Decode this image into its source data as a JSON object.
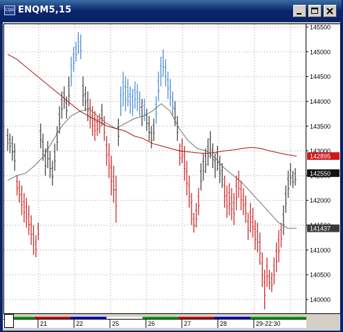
{
  "window": {
    "title": "ENQM5,15",
    "icon": "chart-app-icon",
    "icon_label": "CQG"
  },
  "colors": {
    "up": "#4f8ed6",
    "down": "#cc2a2a",
    "neutral": "#444444",
    "ma_slow": "#b01010",
    "ma_fast": "#707070",
    "label_red": "#cc1a1a",
    "label_black": "#111111",
    "label_grey": "#333333"
  },
  "price_axis": {
    "ticks": [
      "145500",
      "145000",
      "144500",
      "144000",
      "143500",
      "143000",
      "142500",
      "142000",
      "141500",
      "141000",
      "140500",
      "140000"
    ],
    "ylim": [
      139800,
      145600
    ],
    "markers": [
      {
        "value": "142895",
        "kind": "red"
      },
      {
        "value": "142550",
        "kind": "black"
      },
      {
        "value": "141437",
        "kind": "grey"
      }
    ]
  },
  "time_axis": {
    "labels": [
      "21",
      "22",
      "25",
      "26",
      "27",
      "28",
      "29-22:30"
    ],
    "segments": [
      {
        "color": "#00a000"
      },
      {
        "color": "#cc0000"
      },
      {
        "color": "#0000cc"
      },
      {
        "color": "#ffffff"
      },
      {
        "color": "#00a000"
      },
      {
        "color": "#cc0000"
      },
      {
        "color": "#0000cc"
      },
      {
        "color": "#00a000"
      }
    ]
  },
  "chart_data": {
    "type": "bar",
    "title": "ENQM5,15",
    "ylim": [
      139800,
      145600
    ],
    "bars": [
      [
        143450,
        143000,
        "n"
      ],
      [
        143350,
        142950,
        "n"
      ],
      [
        143300,
        142800,
        "n"
      ],
      [
        143150,
        142600,
        "n"
      ],
      [
        142500,
        142100,
        "d"
      ],
      [
        142400,
        141950,
        "d"
      ],
      [
        142300,
        141700,
        "d"
      ],
      [
        142150,
        141550,
        "d"
      ],
      [
        142050,
        141450,
        "d"
      ],
      [
        141900,
        141300,
        "d"
      ],
      [
        141700,
        141100,
        "d"
      ],
      [
        141500,
        140900,
        "d"
      ],
      [
        141300,
        140850,
        "d"
      ],
      [
        141550,
        141200,
        "d"
      ],
      [
        143550,
        143050,
        "n"
      ],
      [
        143350,
        142800,
        "n"
      ],
      [
        143050,
        142500,
        "n"
      ],
      [
        143200,
        142650,
        "n"
      ],
      [
        143000,
        142450,
        "n"
      ],
      [
        142800,
        142300,
        "n"
      ],
      [
        143150,
        142600,
        "n"
      ],
      [
        143500,
        143000,
        "n"
      ],
      [
        143900,
        143350,
        "n"
      ],
      [
        144200,
        143650,
        "n"
      ],
      [
        144300,
        143850,
        "n"
      ],
      [
        144100,
        143650,
        "n"
      ],
      [
        144500,
        143900,
        "n"
      ],
      [
        144900,
        144300,
        "u"
      ],
      [
        145100,
        144600,
        "u"
      ],
      [
        145200,
        144800,
        "u"
      ],
      [
        145400,
        144950,
        "u"
      ],
      [
        145350,
        144850,
        "u"
      ],
      [
        144500,
        143900,
        "n"
      ],
      [
        144300,
        143800,
        "n"
      ],
      [
        144200,
        143600,
        "n"
      ],
      [
        144050,
        143450,
        "d"
      ],
      [
        143900,
        143300,
        "d"
      ],
      [
        143800,
        143200,
        "d"
      ],
      [
        143700,
        143300,
        "d"
      ],
      [
        143750,
        143350,
        "d"
      ],
      [
        143950,
        143500,
        "n"
      ],
      [
        143700,
        143200,
        "d"
      ],
      [
        143300,
        142700,
        "d"
      ],
      [
        143150,
        142450,
        "d"
      ],
      [
        142900,
        142100,
        "d"
      ],
      [
        142700,
        141950,
        "d"
      ],
      [
        142500,
        141550,
        "d"
      ],
      [
        143650,
        143100,
        "n"
      ],
      [
        144300,
        143700,
        "u"
      ],
      [
        144600,
        143900,
        "u"
      ],
      [
        144500,
        143800,
        "u"
      ],
      [
        144450,
        143900,
        "u"
      ],
      [
        144300,
        143750,
        "u"
      ],
      [
        144250,
        143700,
        "u"
      ],
      [
        144400,
        143850,
        "u"
      ],
      [
        144350,
        143800,
        "u"
      ],
      [
        144200,
        143700,
        "u"
      ],
      [
        144050,
        143500,
        "n"
      ],
      [
        144050,
        143600,
        "u"
      ],
      [
        143850,
        143400,
        "n"
      ],
      [
        143700,
        143200,
        "n"
      ],
      [
        143500,
        143050,
        "n"
      ],
      [
        143650,
        143200,
        "n"
      ],
      [
        144100,
        143550,
        "u"
      ],
      [
        144600,
        144000,
        "u"
      ],
      [
        144900,
        144300,
        "u"
      ],
      [
        145050,
        144500,
        "u"
      ],
      [
        144850,
        144300,
        "u"
      ],
      [
        144600,
        144050,
        "u"
      ],
      [
        144450,
        143900,
        "u"
      ],
      [
        144200,
        143700,
        "u"
      ],
      [
        144000,
        143500,
        "n"
      ],
      [
        143700,
        143200,
        "n"
      ],
      [
        143150,
        142700,
        "d"
      ],
      [
        143250,
        142750,
        "d"
      ],
      [
        143100,
        142400,
        "d"
      ],
      [
        142800,
        142100,
        "d"
      ],
      [
        142500,
        141850,
        "d"
      ],
      [
        142150,
        141500,
        "d"
      ],
      [
        141750,
        141350,
        "d"
      ],
      [
        141950,
        141450,
        "d"
      ],
      [
        142250,
        141700,
        "d"
      ],
      [
        142750,
        142200,
        "n"
      ],
      [
        142950,
        142400,
        "n"
      ],
      [
        143050,
        142550,
        "n"
      ],
      [
        143250,
        142700,
        "n"
      ],
      [
        143400,
        142850,
        "n"
      ],
      [
        143150,
        142650,
        "n"
      ],
      [
        142950,
        142450,
        "n"
      ],
      [
        143100,
        142600,
        "n"
      ],
      [
        142900,
        142350,
        "n"
      ],
      [
        142750,
        142250,
        "n"
      ],
      [
        142500,
        141850,
        "d"
      ],
      [
        142300,
        141650,
        "d"
      ],
      [
        142350,
        141700,
        "d"
      ],
      [
        142250,
        141600,
        "d"
      ],
      [
        142150,
        141500,
        "d"
      ],
      [
        142500,
        141800,
        "d"
      ],
      [
        142600,
        142050,
        "d"
      ],
      [
        142400,
        141800,
        "d"
      ],
      [
        142250,
        141700,
        "d"
      ],
      [
        142100,
        141550,
        "d"
      ],
      [
        141750,
        141200,
        "d"
      ],
      [
        141950,
        141350,
        "d"
      ],
      [
        141850,
        141250,
        "d"
      ],
      [
        141600,
        141000,
        "d"
      ],
      [
        141550,
        140950,
        "d"
      ],
      [
        141350,
        140700,
        "d"
      ],
      [
        140950,
        140250,
        "d"
      ],
      [
        140600,
        139800,
        "d"
      ],
      [
        140850,
        140250,
        "d"
      ],
      [
        140600,
        140200,
        "d"
      ],
      [
        140550,
        140150,
        "d"
      ],
      [
        140850,
        140300,
        "d"
      ],
      [
        141150,
        140550,
        "d"
      ],
      [
        141400,
        140750,
        "d"
      ],
      [
        141550,
        141050,
        "d"
      ],
      [
        141900,
        141300,
        "n"
      ],
      [
        142300,
        141750,
        "n"
      ],
      [
        142600,
        142050,
        "n"
      ],
      [
        142750,
        142300,
        "n"
      ],
      [
        142600,
        142250,
        "n"
      ],
      [
        142650,
        142300,
        "n"
      ]
    ],
    "ma_slow": [
      144950,
      144850,
      144700,
      144550,
      144400,
      144250,
      144100,
      143950,
      143800,
      143700,
      143600,
      143500,
      143450,
      143400,
      143300,
      143250,
      143150,
      143100,
      143050,
      143000,
      142980,
      142960,
      142950,
      142970,
      143000,
      143020,
      143050,
      143070,
      143050,
      143000,
      142960,
      142920,
      142895
    ],
    "ma_fast": [
      142400,
      142500,
      142550,
      142700,
      142900,
      143200,
      143500,
      143700,
      143800,
      143850,
      143700,
      143550,
      143450,
      143550,
      143650,
      143700,
      143800,
      143950,
      143800,
      143450,
      143200,
      143050,
      143000,
      142850,
      142650,
      142500,
      142350,
      142150,
      141950,
      141750,
      141550,
      141437,
      141437
    ]
  }
}
